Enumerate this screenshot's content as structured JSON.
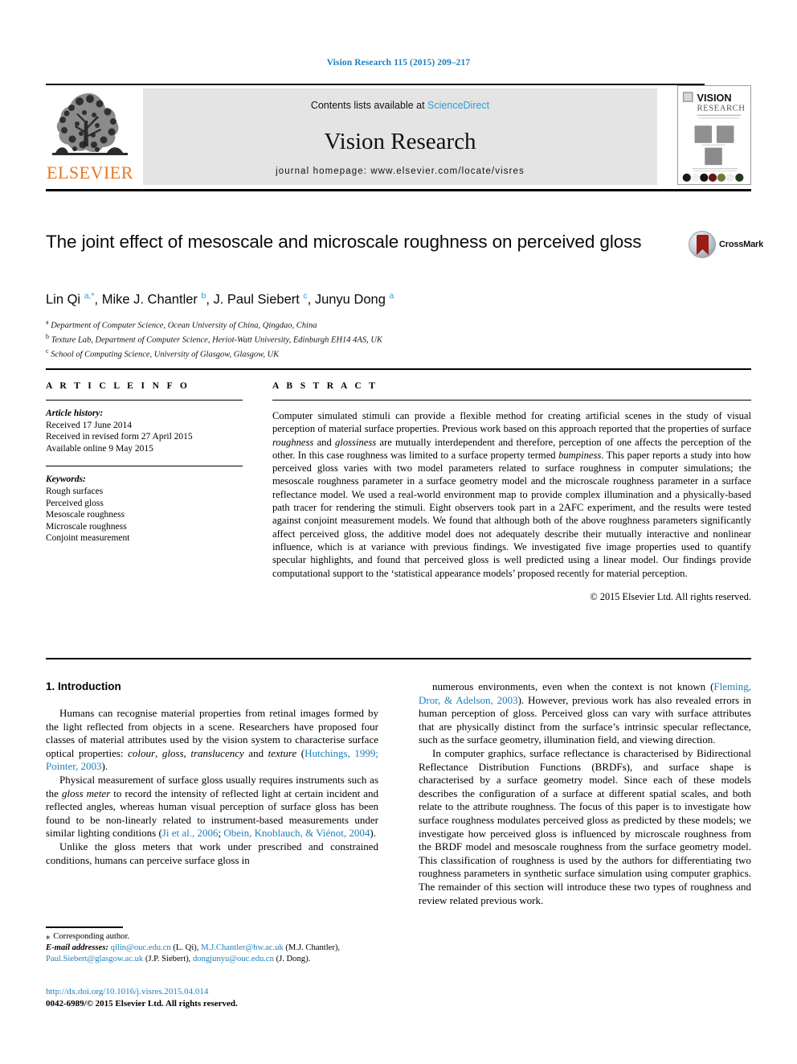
{
  "running_head": "Vision Research 115 (2015) 209–217",
  "masthead": {
    "contents_prefix": "Contents lists available at ",
    "sciencedirect": "ScienceDirect",
    "journal_name": "Vision Research",
    "homepage": "journal homepage: www.elsevier.com/locate/visres",
    "publisher": "ELSEVIER",
    "cover_title_line1": "VISION",
    "cover_title_line2": "RESEARCH",
    "accent_sciencedirect": "#2a9fd6",
    "accent_elsevier": "#e87722"
  },
  "article": {
    "title": "The joint effect of mesoscale and microscale roughness on perceived gloss",
    "crossmark_label": "CrossMark",
    "authors_html": "Lin Qi <sup>a,*</sup>, Mike J. Chantler <sup>b</sup>, J. Paul Siebert <sup>c</sup>, Junyu Dong <sup>a</sup>",
    "affiliations": [
      {
        "mark": "a",
        "text": "Department of Computer Science, Ocean University of China, Qingdao, China"
      },
      {
        "mark": "b",
        "text": "Texture Lab, Department of Computer Science, Heriot-Watt University, Edinburgh EH14 4AS, UK"
      },
      {
        "mark": "c",
        "text": "School of Computing Science, University of Glasgow, Glasgow, UK"
      }
    ]
  },
  "article_info": {
    "heading": "A R T I C L E   I N F O",
    "history_label": "Article history:",
    "history": [
      "Received 17 June 2014",
      "Received in revised form 27 April 2015",
      "Available online 9 May 2015"
    ],
    "keywords_label": "Keywords:",
    "keywords": [
      "Rough surfaces",
      "Perceived gloss",
      "Mesoscale roughness",
      "Microscale roughness",
      "Conjoint measurement"
    ]
  },
  "abstract": {
    "heading": "A B S T R A C T",
    "body_html": "Computer simulated stimuli can provide a flexible method for creating artificial scenes in the study of visual perception of material surface properties. Previous work based on this approach reported that the properties of surface <i>roughness</i> and <i>glossiness</i> are mutually interdependent and therefore, perception of one affects the perception of the other. In this case roughness was limited to a surface property termed <i>bumpiness</i>. This paper reports a study into how perceived gloss varies with two model parameters related to surface roughness in computer simulations; the mesoscale roughness parameter in a surface geometry model and the microscale roughness parameter in a surface reflectance model. We used a real-world environment map to provide complex illumination and a physically-based path tracer for rendering the stimuli. Eight observers took part in a 2AFC experiment, and the results were tested against conjoint measurement models. We found that although both of the above roughness parameters significantly affect perceived gloss, the additive model does not adequately describe their mutually interactive and nonlinear influence, which is at variance with previous findings. We investigated five image properties used to quantify specular highlights, and found that perceived gloss is well predicted using a linear model. Our findings provide computational support to the ‘statistical appearance models’ proposed recently for material perception.",
    "copyright": "© 2015 Elsevier Ltd. All rights reserved."
  },
  "body": {
    "section_heading": "1. Introduction",
    "left_paragraphs_html": [
      "Humans can recognise material properties from retinal images formed by the light reflected from objects in a scene. Researchers have proposed four classes of material attributes used by the vision system to characterise surface optical properties: <i>colour</i>, <i>gloss</i>, <i>translucency</i> and <i>texture</i> (<span class=\"ref\">Hutchings, 1999; Pointer, 2003</span>).",
      "Physical measurement of surface gloss usually requires instruments such as the <i>gloss meter</i> to record the intensity of reflected light at certain incident and reflected angles, whereas human visual perception of surface gloss has been found to be non-linearly related to instrument-based measurements under similar lighting conditions (<span class=\"ref\">Ji et al., 2006</span>; <span class=\"ref\">Obein, Knoblauch, &amp; Viénot, 2004</span>).",
      "Unlike the gloss meters that work under prescribed and constrained conditions, humans can perceive surface gloss in"
    ],
    "right_paragraphs_html": [
      "numerous environments, even when the context is not known (<span class=\"ref\">Fleming, Dror, &amp; Adelson, 2003</span>). However, previous work has also revealed errors in human perception of gloss. Perceived gloss can vary with surface attributes that are physically distinct from the surface’s intrinsic specular reflectance, such as the surface geometry, illumination field, and viewing direction.",
      "In computer graphics, surface reflectance is characterised by Bidirectional Reflectance Distribution Functions (BRDFs), and surface shape is characterised by a surface geometry model. Since each of these models describes the configuration of a surface at different spatial scales, and both relate to the attribute roughness. The focus of this paper is to investigate how surface roughness modulates perceived gloss as predicted by these models; we investigate how perceived gloss is influenced by microscale roughness from the BRDF model and mesoscale roughness from the surface geometry model. This classification of roughness is used by the authors for differentiating two roughness parameters in synthetic surface simulation using computer graphics. The remainder of this section will introduce these two types of roughness and review related previous work."
    ]
  },
  "footer": {
    "corresponding_author": "Corresponding author.",
    "email_label": "E-mail addresses:",
    "emails_html": "<span class=\"mail\">qilin@ouc.edu.cn</span> (L. Qi), <span class=\"mail\">M.J.Chantler@hw.ac.uk</span> (M.J. Chantler), <span class=\"mail\">Paul.Siebert@glasgow.ac.uk</span> (J.P. Siebert), <span class=\"mail\">dongjunyu@ouc.edu.cn</span> (J. Dong).",
    "doi": "http://dx.doi.org/10.1016/j.visres.2015.04.014",
    "issn_line": "0042-6989/© 2015 Elsevier Ltd. All rights reserved."
  }
}
